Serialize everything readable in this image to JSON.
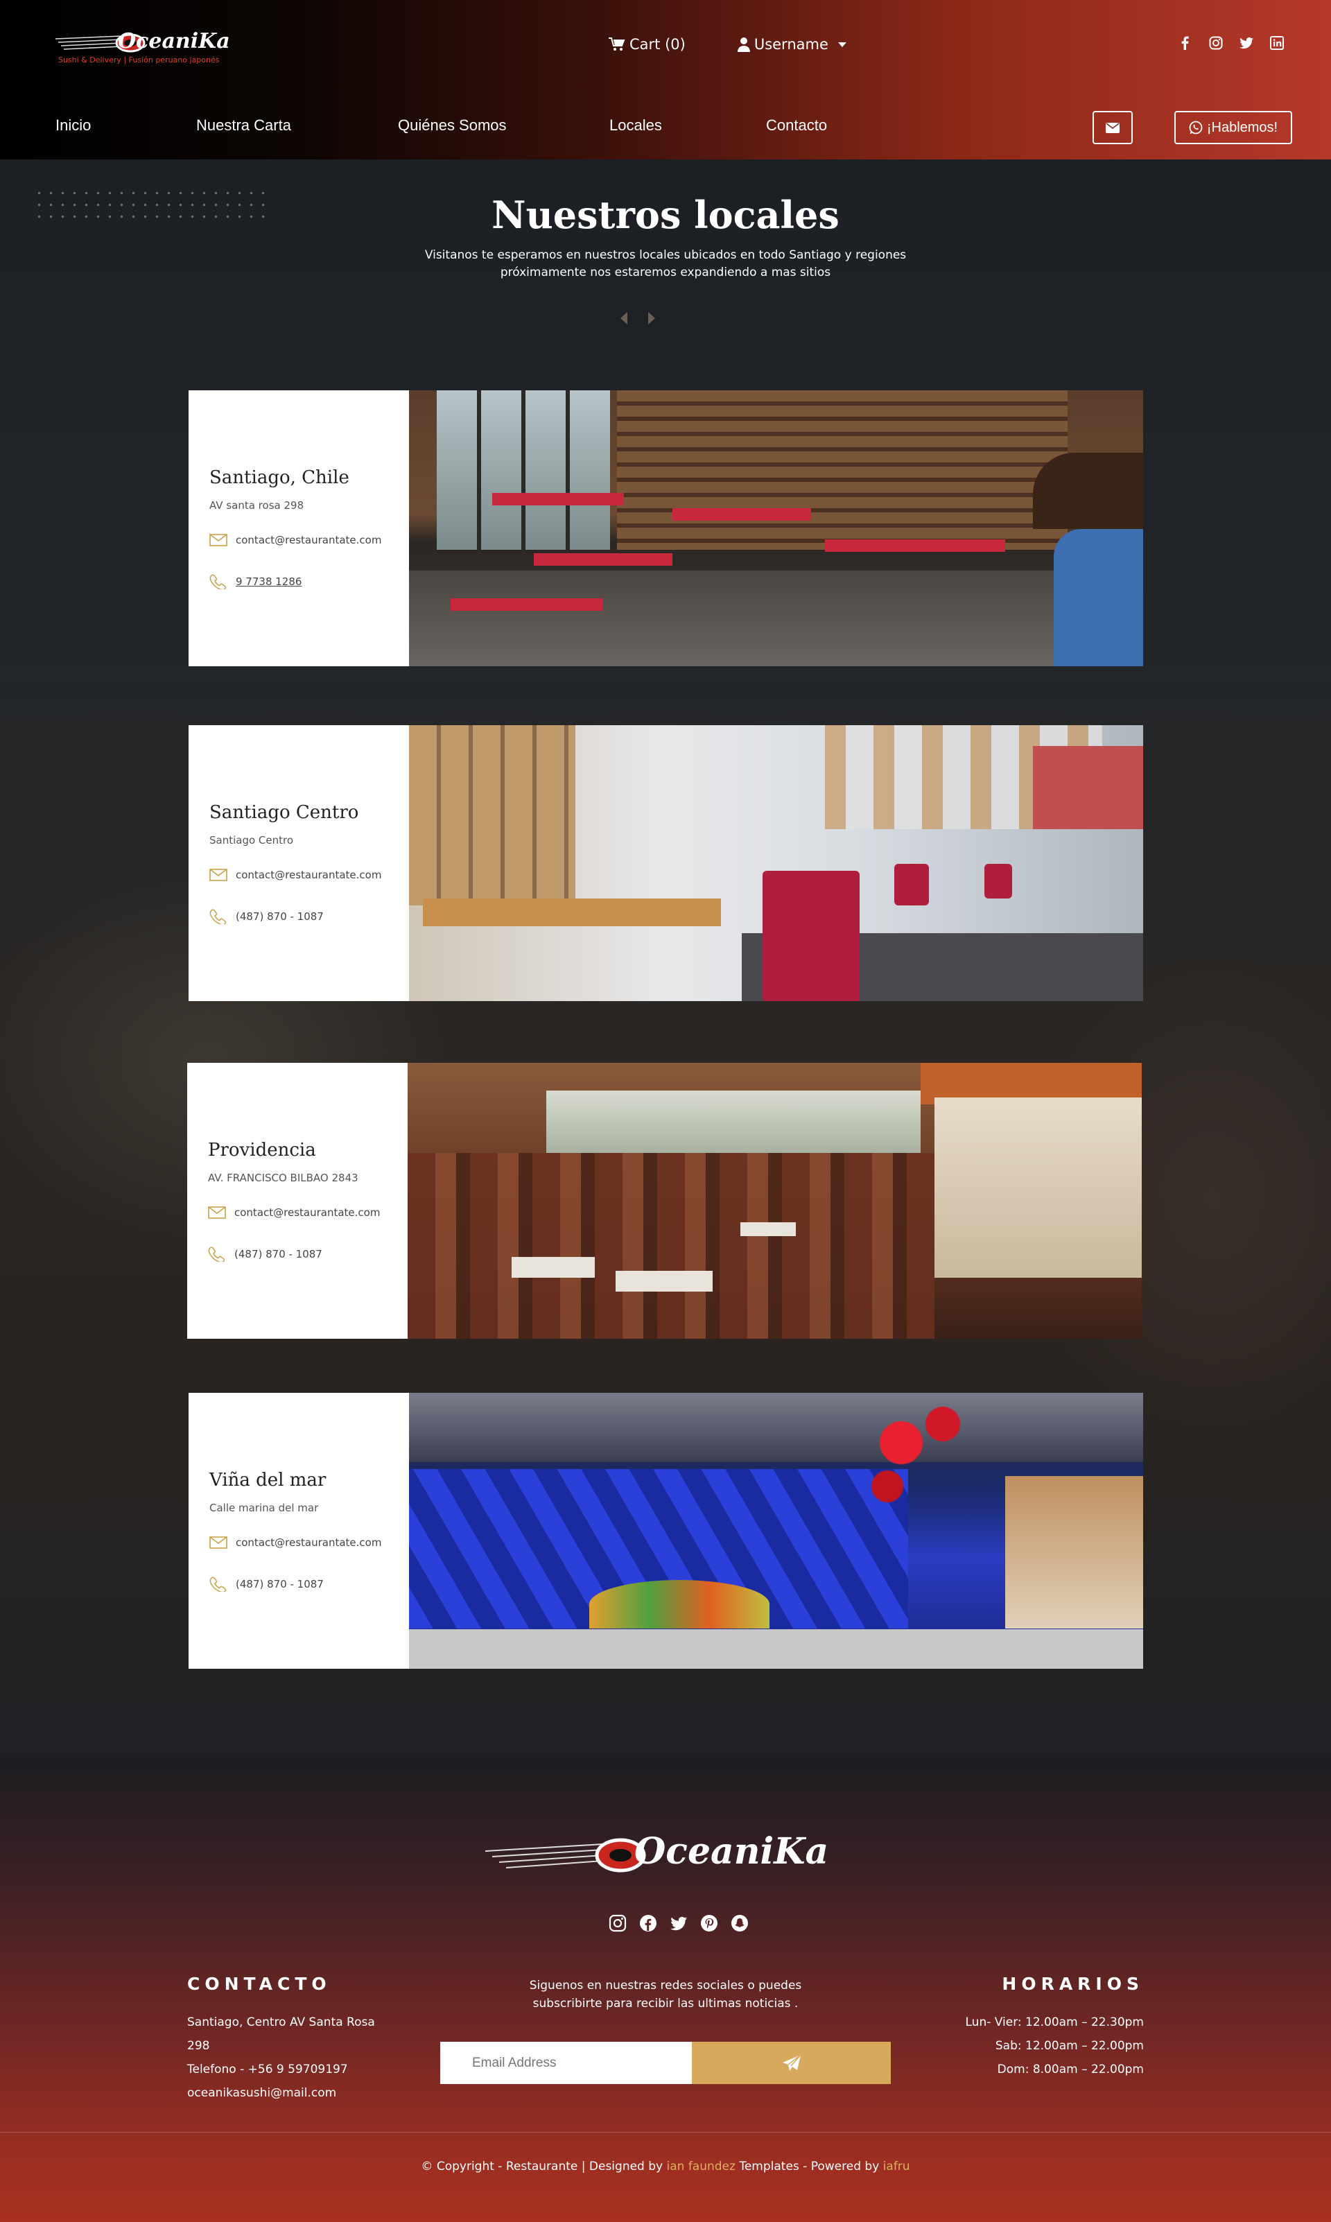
{
  "header": {
    "logo": {
      "brand": "OceaniKa",
      "tagline": "Sushi & Delivery | Fusión peruano japonés"
    },
    "cart_label": "Cart (0)",
    "user_label": "Username",
    "nav": [
      {
        "label": "Inicio"
      },
      {
        "label": "Nuestra Carta"
      },
      {
        "label": "Quiénes Somos"
      },
      {
        "label": "Locales"
      },
      {
        "label": "Contacto"
      }
    ],
    "hablemos_label": "¡Hablemos!",
    "social_icons": [
      "facebook-icon",
      "instagram-icon",
      "twitter-icon",
      "linkedin-icon"
    ]
  },
  "section": {
    "title": "Nuestros locales",
    "subtitle": "Visitanos te esperamos en nuestros locales ubicados en todo Santiago y regiones próximamente nos estaremos expandiendo a mas sitios"
  },
  "locations": [
    {
      "name": "Santiago, Chile",
      "address": "AV santa rosa 298",
      "email": "contact@restaurantate.com",
      "phone": "9 7738 1286"
    },
    {
      "name": "Santiago Centro",
      "address": "Santiago Centro",
      "email": "contact@restaurantate.com",
      "phone": "(487) 870 - 1087"
    },
    {
      "name": "Providencia",
      "address": "AV. FRANCISCO BILBAO 2843",
      "email": "contact@restaurantate.com",
      "phone": "(487) 870 - 1087"
    },
    {
      "name": "Viña del mar",
      "address": "Calle marina del mar",
      "email": "contact@restaurantate.com",
      "phone": "(487) 870 - 1087"
    }
  ],
  "footer": {
    "brand": "OceaniKa",
    "social_icons": [
      "instagram-icon",
      "facebook-icon",
      "twitter-icon",
      "pinterest-icon",
      "snapchat-icon"
    ],
    "contact_heading": "CONTACTO",
    "contact_lines": [
      "Santiago, Centro AV Santa Rosa 298",
      "Telefono - +56 9 59709197",
      "oceanikasushi@mail.com"
    ],
    "follow_text": "Siguenos en nuestras redes sociales o puedes subscribirte para recibir las ultimas noticias .",
    "email_placeholder": "Email Address",
    "hours_heading": "HORARIOS",
    "hours": [
      "Lun- Vier: 12.00am – 22.30pm",
      "Sab: 12.00am – 22.00pm",
      "Dom: 8.00am – 22.00pm"
    ],
    "copyright_prefix": "© Copyright - Restaurante | Designed by ",
    "designer": "ian faundez",
    "copyright_mid": " Templates - Powered by ",
    "powered": "iafru"
  },
  "colors": {
    "accent": "#d7a95c",
    "header_red": "#b5382a",
    "icon_gold": "#c9a24a"
  }
}
